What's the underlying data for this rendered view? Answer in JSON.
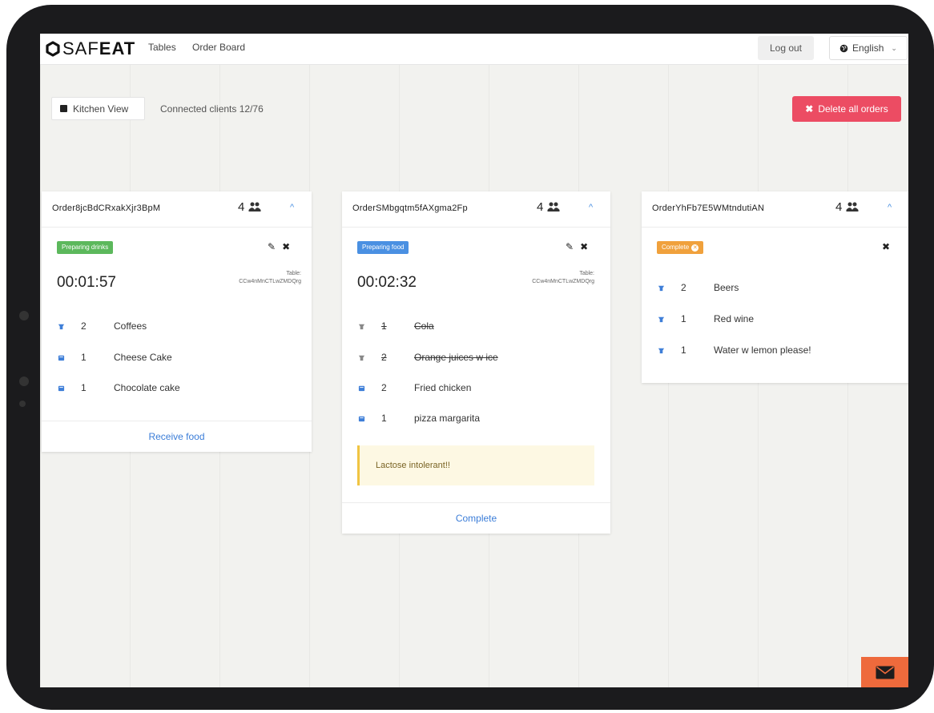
{
  "brand": {
    "logo_prefix": "SAF",
    "logo_suffix": "EAT"
  },
  "nav": {
    "links": [
      "Tables",
      "Order Board"
    ],
    "logout_label": "Log out",
    "language_label": "English"
  },
  "toolbar": {
    "kitchen_view_label": "Kitchen View",
    "connected_clients": "Connected clients 12/76",
    "delete_all_label": "Delete all orders"
  },
  "colors": {
    "badge_drinks": "#5cb85c",
    "badge_food": "#4a90e2",
    "badge_complete": "#f0a13c",
    "danger": "#ec4c63",
    "link": "#3b7dd8"
  },
  "orders": [
    {
      "id": "Order8jcBdCRxakXjr3BpM",
      "people": "4",
      "status": "Preparing drinks",
      "timer": "00:01:57",
      "table_label": "Table:",
      "table_id": "CCw4nMnCTLwZMDQrg",
      "items": [
        {
          "type": "drink",
          "qty": "2",
          "name": "Coffees",
          "done": false
        },
        {
          "type": "food",
          "qty": "1",
          "name": "Cheese Cake",
          "done": false
        },
        {
          "type": "food",
          "qty": "1",
          "name": "Chocolate cake",
          "done": false
        }
      ],
      "footer": "Receive food"
    },
    {
      "id": "OrderSMbgqtm5fAXgma2Fp",
      "people": "4",
      "status": "Preparing food",
      "timer": "00:02:32",
      "table_label": "Table:",
      "table_id": "CCw4nMnCTLwZMDQrg",
      "items": [
        {
          "type": "drink",
          "qty": "1",
          "name": "Cola",
          "done": true
        },
        {
          "type": "drink",
          "qty": "2",
          "name": "Orange juices w ice",
          "done": true
        },
        {
          "type": "food",
          "qty": "2",
          "name": "Fried chicken",
          "done": false
        },
        {
          "type": "food",
          "qty": "1",
          "name": "pizza margarita",
          "done": false
        }
      ],
      "note": "Lactose intolerant!!",
      "footer": "Complete"
    },
    {
      "id": "OrderYhFb7E5WMtndutiAN",
      "people": "4",
      "status": "Complete",
      "items": [
        {
          "type": "drink",
          "qty": "2",
          "name": "Beers",
          "done": false
        },
        {
          "type": "drink",
          "qty": "1",
          "name": "Red wine",
          "done": false
        },
        {
          "type": "drink",
          "qty": "1",
          "name": "Water w lemon please!",
          "done": false
        }
      ]
    }
  ]
}
